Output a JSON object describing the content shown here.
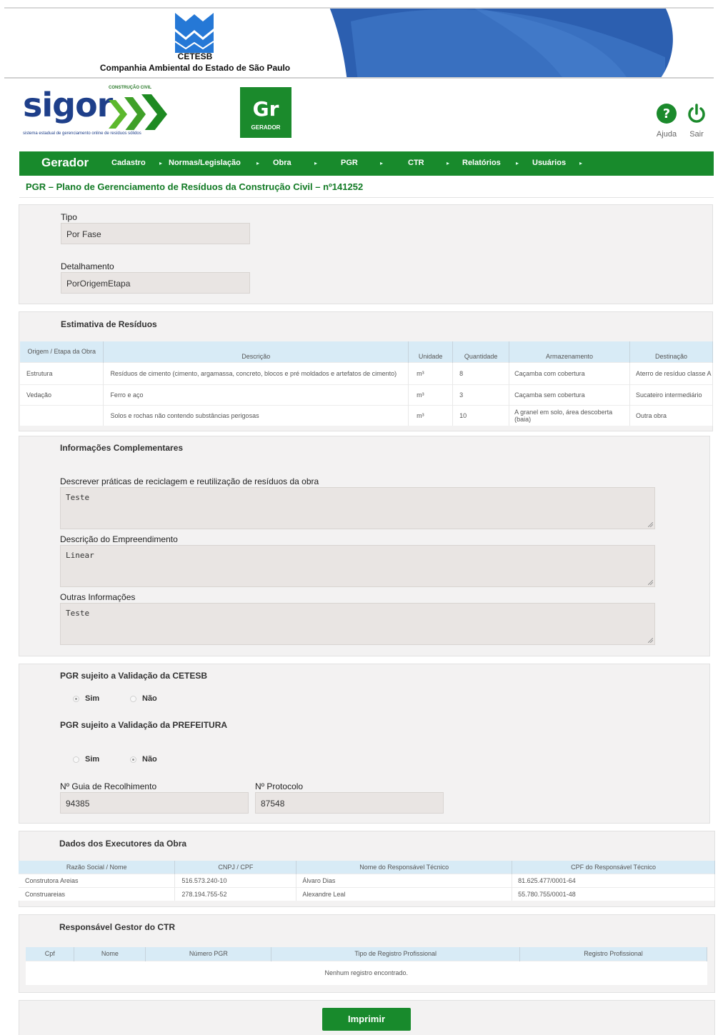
{
  "banner": {
    "org_short": "CETESB",
    "org_full": "Companhia Ambiental do Estado de São Paulo",
    "colors": {
      "cetesb_blue": "#1e6fd0",
      "swoosh_blue": "#2c5fb0"
    }
  },
  "sigor": {
    "name": "sigor",
    "tag": "CONSTRUÇÃO CIVIL",
    "subtitle": "sistema estadual de gerenciamento online de resíduos sólidos"
  },
  "role_badge": {
    "abbr": "Gr",
    "label": "GERADOR"
  },
  "header_actions": {
    "help": "Ajuda",
    "exit": "Sair"
  },
  "nav": {
    "brand": "Gerador",
    "items": [
      "Cadastro",
      "Normas/Legislação",
      "Obra",
      "PGR",
      "CTR",
      "Relatórios",
      "Usuários"
    ]
  },
  "page_title": "PGR – Plano de Gerenciamento de Resíduos da Construção Civil – nº141252",
  "tipo": {
    "label": "Tipo",
    "value": "Por Fase"
  },
  "detalhamento": {
    "label": "Detalhamento",
    "value": "PorOrigemEtapa"
  },
  "estimativa": {
    "title": "Estimativa de Resíduos",
    "headers": [
      "Origem / Etapa da Obra",
      "Descrição",
      "Unidade",
      "Quantidade",
      "Armazenamento",
      "Destinação"
    ],
    "rows": [
      [
        "Estrutura",
        "Resíduos de cimento (cimento, argamassa, concreto, blocos e pré moldados e artefatos de cimento)",
        "m³",
        "8",
        "Caçamba com cobertura",
        "Aterro de resíduo classe A"
      ],
      [
        "Vedação",
        "Ferro e aço",
        "m³",
        "3",
        "Caçamba sem cobertura",
        "Sucateiro intermediário"
      ],
      [
        "",
        "Solos e rochas não contendo substâncias perigosas",
        "m³",
        "10",
        "A granel em solo, área descoberta (baia)",
        "Outra obra"
      ]
    ]
  },
  "complementares": {
    "title": "Informações Complementares",
    "praticas_label": "Descrever práticas de reciclagem e reutilização de resíduos da obra",
    "praticas_value": "Teste",
    "empreendimento_label": "Descrição do Empreendimento",
    "empreendimento_value": "Linear",
    "outras_label": "Outras Informações",
    "outras_value": "Teste"
  },
  "validacao": {
    "cetesb_label": "PGR sujeito a Validação da CETESB",
    "cetesb_selected": "Sim",
    "prefeitura_label": "PGR sujeito a Validação da PREFEITURA",
    "prefeitura_selected": "Não",
    "sim": "Sim",
    "nao": "Não",
    "guia_label": "Nº Guia de Recolhimento",
    "guia_value": "94385",
    "protocolo_label": "Nº Protocolo",
    "protocolo_value": "87548"
  },
  "executores": {
    "title": "Dados dos Executores da Obra",
    "headers": [
      "Razão Social / Nome",
      "CNPJ / CPF",
      "Nome do Responsável Técnico",
      "CPF do Responsável Técnico"
    ],
    "rows": [
      [
        "Construtora Areias",
        "516.573.240-10",
        "Álvaro Dias",
        "81.625.477/0001-64"
      ],
      [
        "Construareias",
        "278.194.755-52",
        "Alexandre Leal",
        "55.780.755/0001-48"
      ]
    ]
  },
  "gestor": {
    "title": "Responsável Gestor do CTR",
    "headers": [
      "Cpf",
      "Nome",
      "Número PGR",
      "Tipo de Registro Profissional",
      "Registro Profissional"
    ],
    "empty": "Nenhum registro encontrado."
  },
  "print_button": "Imprimir",
  "colors": {
    "primary_green": "#188a2c",
    "title_green": "#117a24",
    "header_blue": "#d8ebf6"
  }
}
